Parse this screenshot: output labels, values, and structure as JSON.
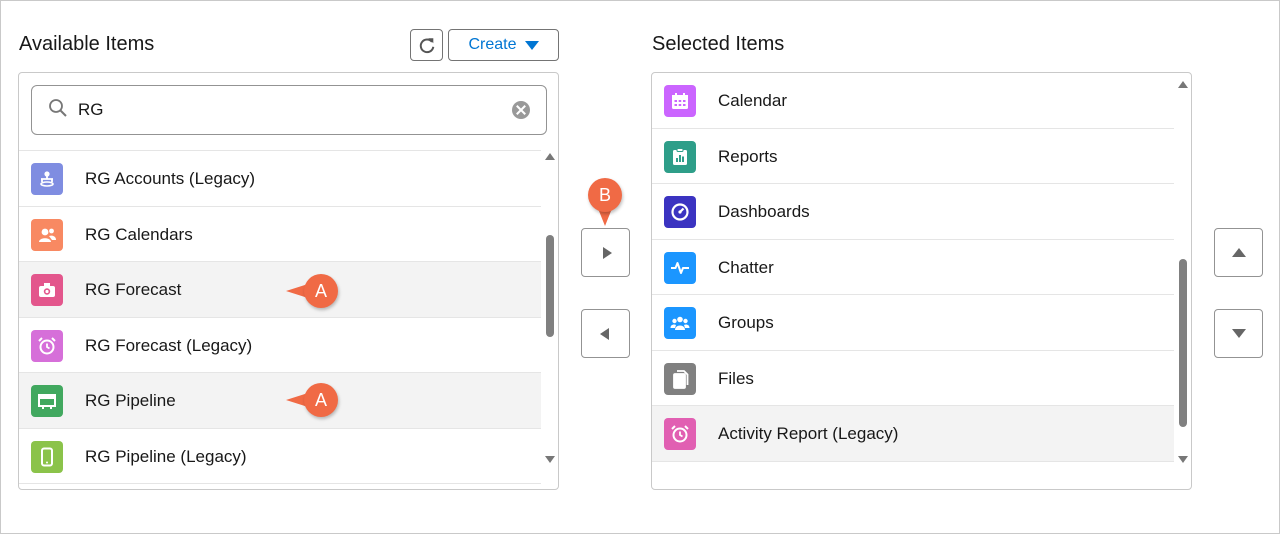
{
  "available": {
    "heading": "Available Items",
    "create_label": "Create",
    "search": {
      "value": "RG"
    },
    "items": [
      {
        "label": "RG Accounts (Legacy)",
        "icon": "hierarchy-icon",
        "color": "#7f8de1",
        "selected": false
      },
      {
        "label": "RG Calendars",
        "icon": "people-icon",
        "color": "#f88962",
        "selected": false
      },
      {
        "label": "RG Forecast",
        "icon": "camera-icon",
        "color": "#e3568c",
        "selected": true
      },
      {
        "label": "RG Forecast (Legacy)",
        "icon": "alarm-clock-icon",
        "color": "#d66fd9",
        "selected": false
      },
      {
        "label": "RG Pipeline",
        "icon": "pipeline-icon",
        "color": "#41a85f",
        "selected": true
      },
      {
        "label": "RG Pipeline (Legacy)",
        "icon": "mobile-icon",
        "color": "#8bc34a",
        "selected": false
      }
    ]
  },
  "selected": {
    "heading": "Selected Items",
    "items": [
      {
        "label": "Calendar",
        "icon": "calendar-icon",
        "color": "#cb65ff",
        "selected": false
      },
      {
        "label": "Reports",
        "icon": "report-clipboard-icon",
        "color": "#2e9e89",
        "selected": false
      },
      {
        "label": "Dashboards",
        "icon": "gauge-icon",
        "color": "#3b33c1",
        "selected": false
      },
      {
        "label": "Chatter",
        "icon": "pulse-icon",
        "color": "#1b96ff",
        "selected": false
      },
      {
        "label": "Groups",
        "icon": "group-icon",
        "color": "#1b96ff",
        "selected": false
      },
      {
        "label": "Files",
        "icon": "files-icon",
        "color": "#808080",
        "selected": false
      },
      {
        "label": "Activity Report (Legacy)",
        "icon": "alarm-clock-icon",
        "color": "#e15fb2",
        "selected": true
      }
    ]
  },
  "callouts": {
    "a": "A",
    "b": "B"
  }
}
